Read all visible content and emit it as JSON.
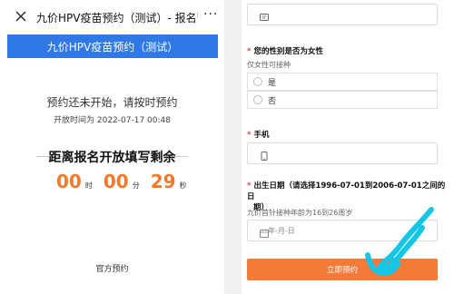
{
  "left": {
    "window_title": "九价HPV疫苗预约（测试）- 报名暂未...",
    "more_icon": "···",
    "header_bar": "九价HPV疫苗预约（测试）",
    "notice": "预约还未开始，请按时预约",
    "open_time": "开放时间为 2022-07-17 00:48",
    "countdown_title": "距离报名开放填写剩余",
    "countdown": {
      "hours": "00",
      "hours_unit": "时",
      "minutes": "00",
      "minutes_unit": "分",
      "seconds": "29",
      "seconds_unit": "秒"
    },
    "official": "官方预约"
  },
  "right": {
    "gender_label": "您的性别是否为女性",
    "gender_desc": "仅女性可接种",
    "options": [
      "是",
      "否"
    ],
    "phone_label": "手机",
    "birth_label_line1": "出生日期（请选择1996-07-01到2006-07-01之间的日",
    "birth_label_line2": "期）",
    "birth_desc": "九价首针接种年龄为16到26周岁",
    "date_placeholder": "年-月-日",
    "submit_label": "立即预约",
    "required_mark": "*"
  },
  "colors": {
    "primary_blue": "#2f79e6",
    "countdown_orange": "#f27a2a",
    "submit_orange": "#f47a3a",
    "required_red": "#e8413c",
    "annotation_cyan": "#14c5e6"
  },
  "icons": {
    "close": "close-icon",
    "more": "more-icon",
    "id_card": "id-card-icon",
    "phone": "phone-icon",
    "calendar": "calendar-icon"
  }
}
